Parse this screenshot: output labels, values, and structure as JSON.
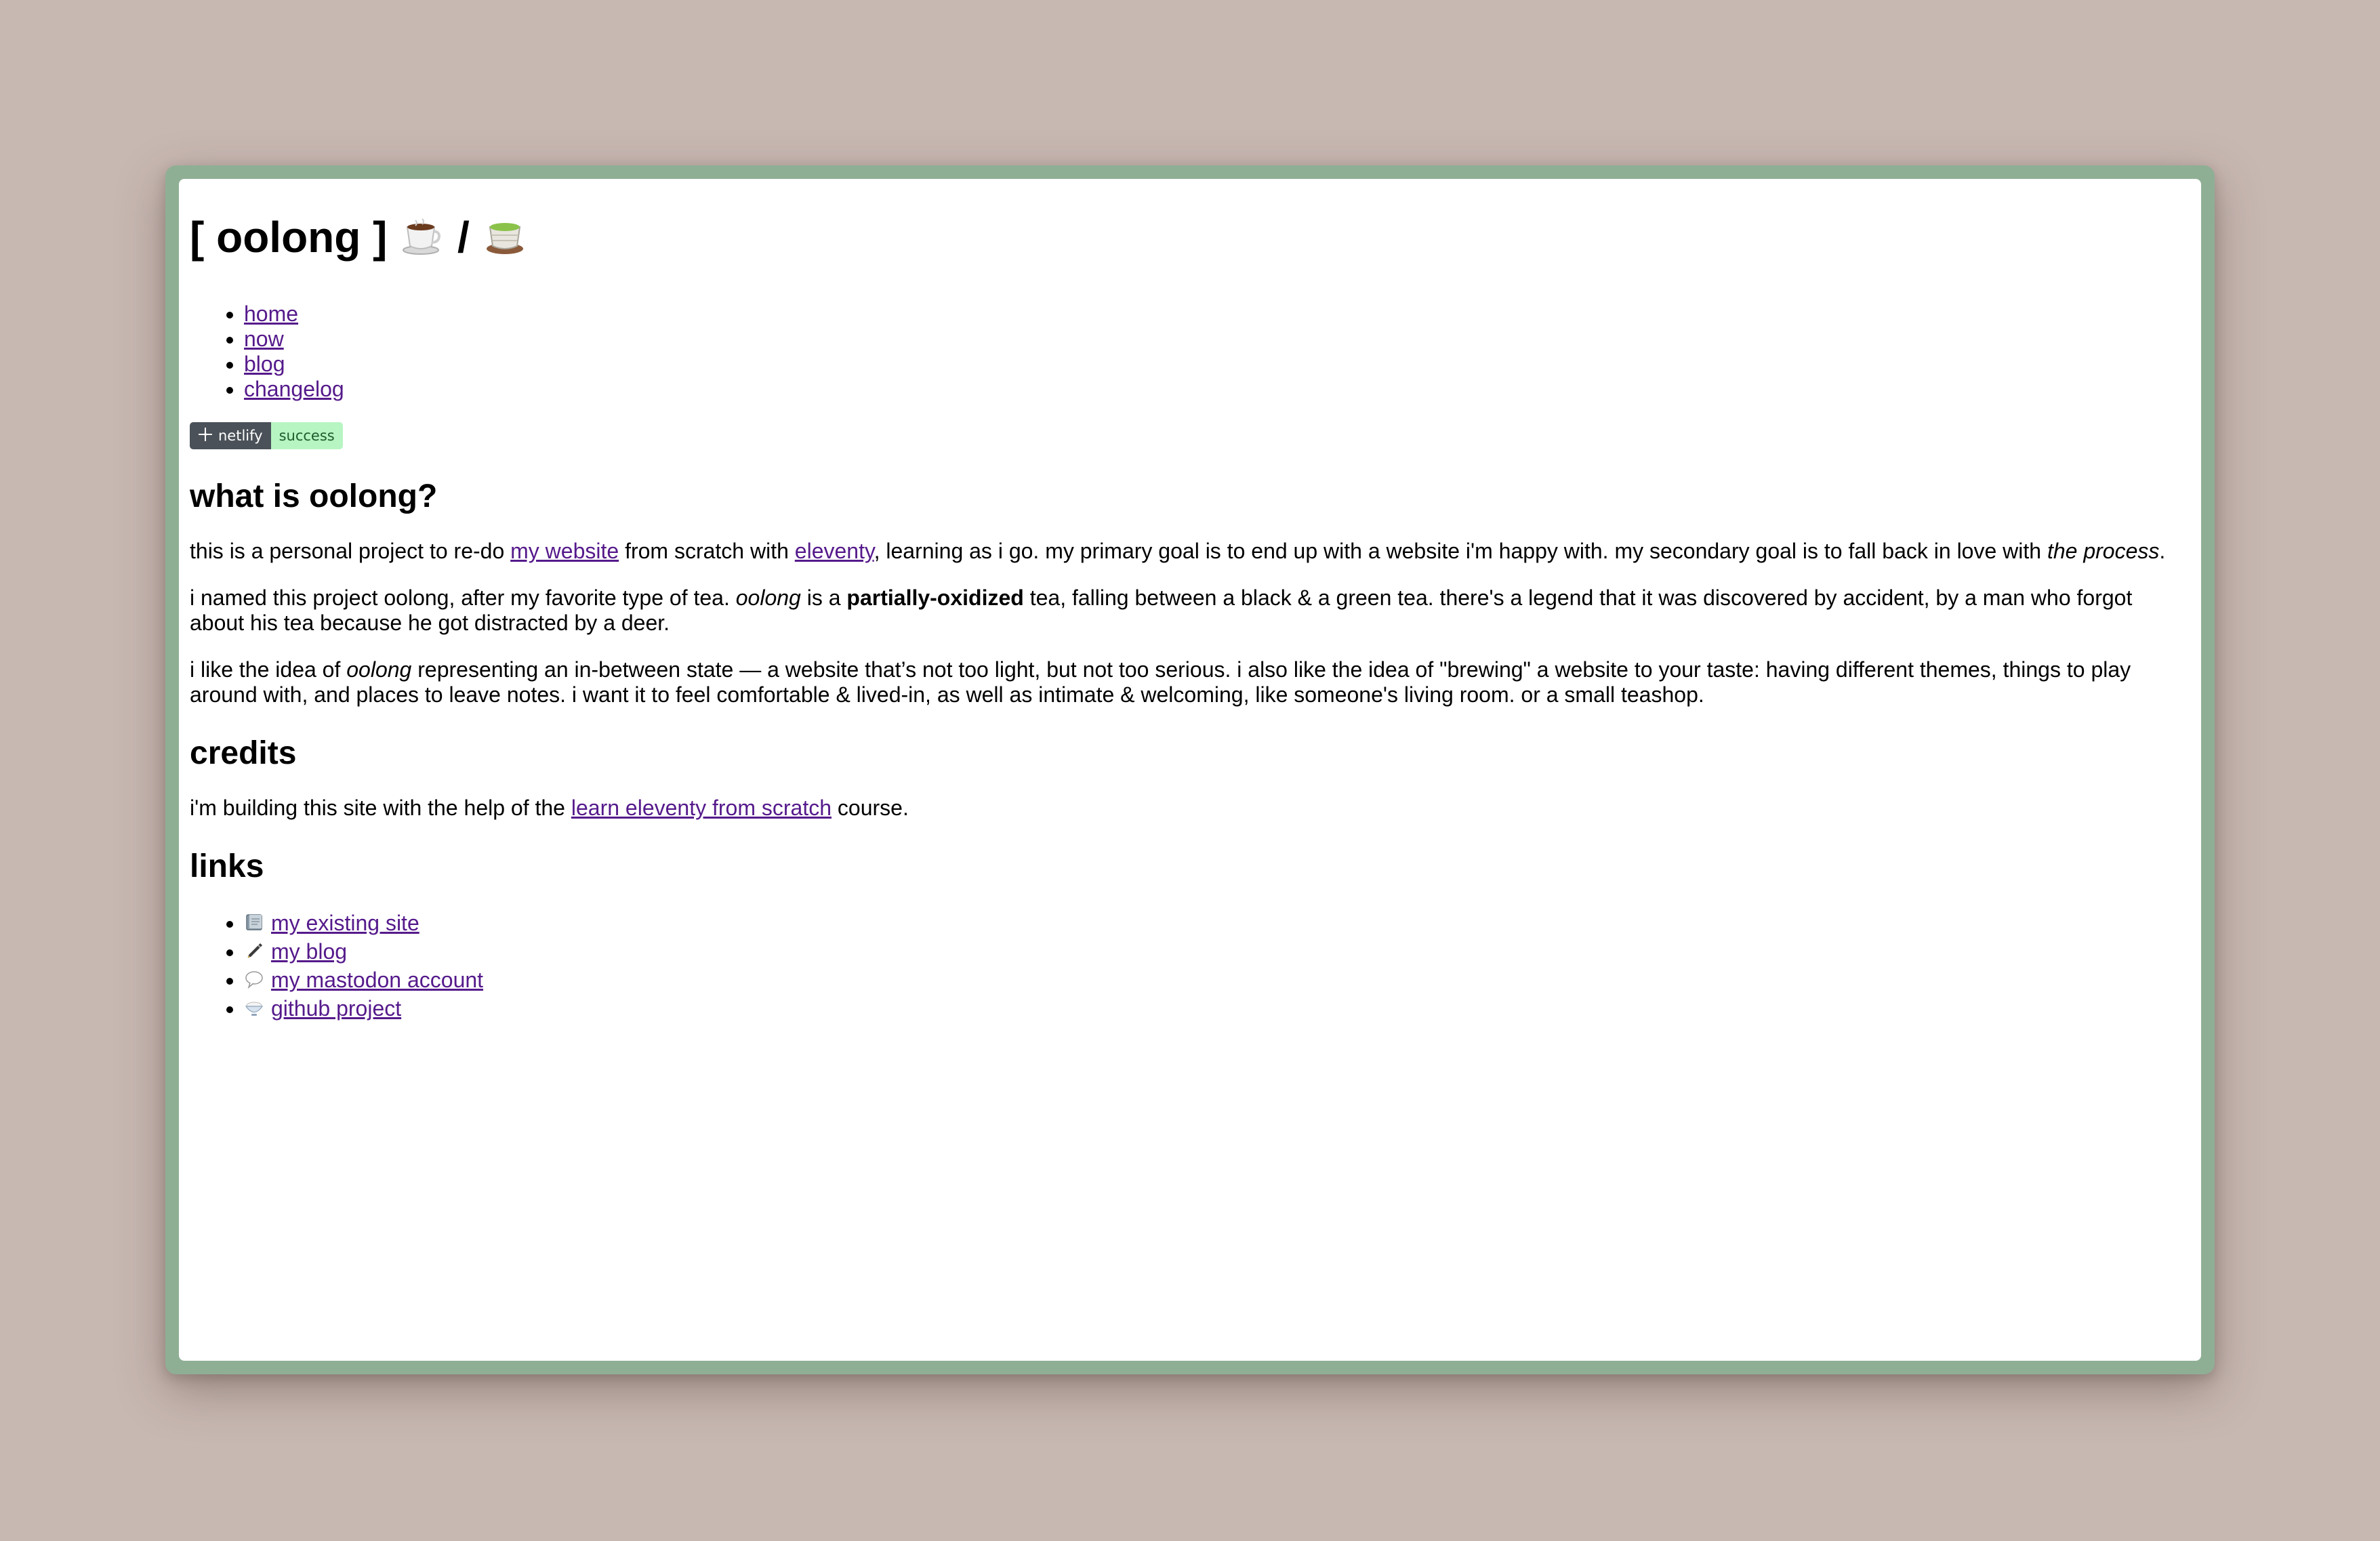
{
  "site": {
    "title": "[ oolong ]",
    "separator": "/",
    "title_icons": [
      "coffee-cup-icon",
      "green-tea-icon"
    ]
  },
  "nav": {
    "items": [
      {
        "label": "home"
      },
      {
        "label": "now"
      },
      {
        "label": "blog"
      },
      {
        "label": "changelog"
      }
    ]
  },
  "badge": {
    "label": "netlify",
    "status": "success",
    "colors": {
      "left": "#4b5158",
      "right": "#b7f5c3"
    }
  },
  "about": {
    "heading": "what is oolong?",
    "p1": {
      "t1": "this is a personal project to re-do ",
      "link1": "my website",
      "t2": " from scratch with ",
      "link2": "eleventy",
      "t3": ", learning as i go. my primary goal is to end up with a website i'm happy with. my secondary goal is to fall back in love with ",
      "em": "the process",
      "t4": "."
    },
    "p2": {
      "t1": "i named this project oolong, after my favorite type of tea. ",
      "em": "oolong",
      "t2": " is a ",
      "strong": "partially-oxidized",
      "t3": " tea, falling between a black & a green tea. there's a legend that it was discovered by accident, by a man who forgot about his tea because he got distracted by a deer."
    },
    "p3": {
      "t1": "i like the idea of ",
      "em": "oolong",
      "t2": " representing an in-between state — a website that’s not too light, but not too serious. i also like the idea of \"brewing\" a website to your taste: having different themes, things to play around with, and places to leave notes. i want it to feel comfortable & lived-in, as well as intimate & welcoming, like someone's living room. or a small teashop."
    }
  },
  "credits": {
    "heading": "credits",
    "t1": "i'm building this site with the help of the ",
    "link": "learn eleventy from scratch",
    "t2": " course."
  },
  "links": {
    "heading": "links",
    "items": [
      {
        "icon": "notebook-icon",
        "label": "my existing site"
      },
      {
        "icon": "pen-icon",
        "label": "my blog"
      },
      {
        "icon": "speech-bubble-icon",
        "label": "my mastodon account"
      },
      {
        "icon": "rice-bowl-icon",
        "label": "github project"
      }
    ]
  },
  "colors": {
    "background": "#c8b8b2",
    "window_frame": "#8faf95",
    "link": "#551a8b"
  }
}
